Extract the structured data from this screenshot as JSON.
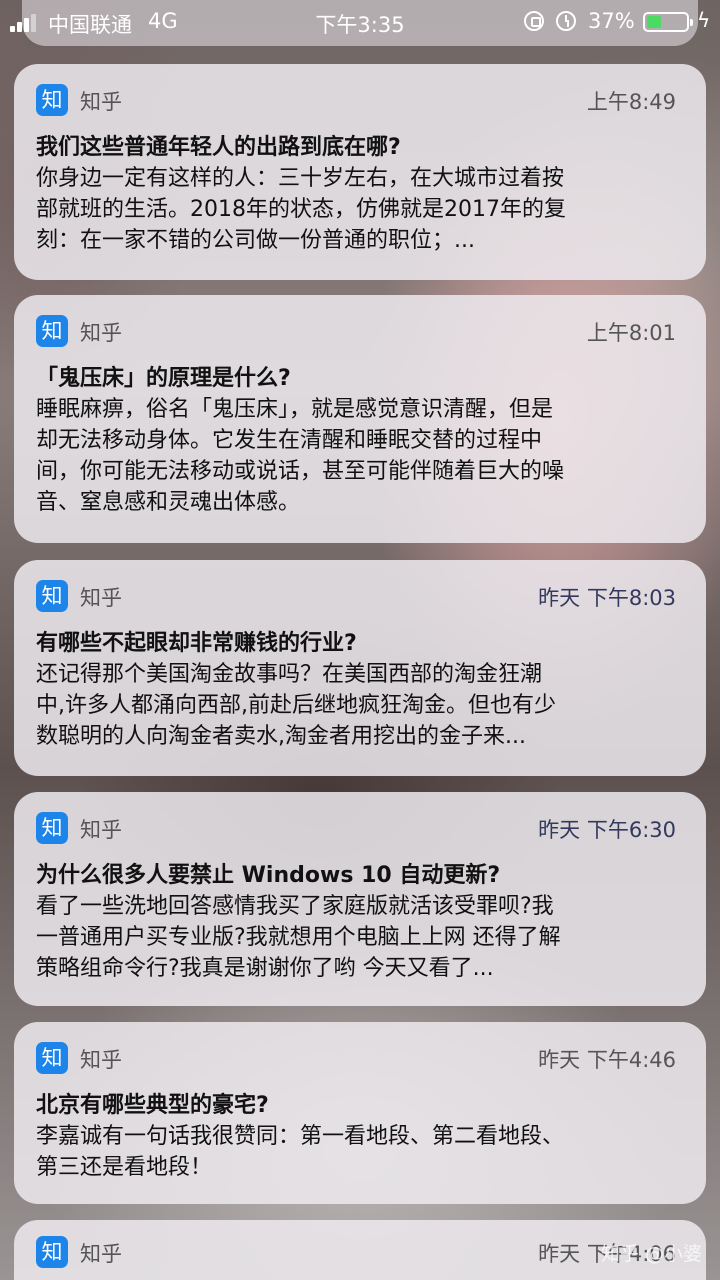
{
  "status_bar": {
    "carrier": "中国联通",
    "network": "4G",
    "time": "下午3:35",
    "battery_percent": "37%",
    "battery_level": 0.37,
    "battery_color": "#4cd964"
  },
  "notifications": [
    {
      "app_icon": "知",
      "app_name": "知乎",
      "time": "上午8:49",
      "title": "我们这些普通年轻人的出路到底在哪?",
      "body": [
        "你身边一定有这样的人：三十岁左右，在大城市过着按",
        "部就班的生活。2018年的状态，仿佛就是2017年的复",
        "刻：在一家不错的公司做一份普通的职位；..."
      ]
    },
    {
      "app_icon": "知",
      "app_name": "知乎",
      "time": "上午8:01",
      "title": "「鬼压床」的原理是什么?",
      "body": [
        "睡眠麻痹，俗名「鬼压床」，就是感觉意识清醒，但是",
        "却无法移动身体。它发生在清醒和睡眠交替的过程中",
        "间，你可能无法移动或说话，甚至可能伴随着巨大的噪",
        "音、窒息感和灵魂出体感。"
      ]
    },
    {
      "app_icon": "知",
      "app_name": "知乎",
      "time": "昨天 下午8:03",
      "title": "有哪些不起眼却非常赚钱的行业?",
      "body": [
        "还记得那个美国淘金故事吗？在美国西部的淘金狂潮",
        "中,许多人都涌向西部,前赴后继地疯狂淘金。但也有少",
        "数聪明的人向淘金者卖水,淘金者用挖出的金子来..."
      ]
    },
    {
      "app_icon": "知",
      "app_name": "知乎",
      "time": "昨天 下午6:30",
      "title": "为什么很多人要禁止 Windows 10 自动更新?",
      "body": [
        "看了一些洗地回答感情我买了家庭版就活该受罪呗?我",
        "一普通用户买专业版?我就想用个电脑上上网 还得了解",
        "策略组命令行?我真是谢谢你了哟 今天又看了..."
      ]
    },
    {
      "app_icon": "知",
      "app_name": "知乎",
      "time": "昨天 下午4:46",
      "title": "北京有哪些典型的豪宅?",
      "body": [
        "李嘉诚有一句话我很赞同：第一看地段、第二看地段、",
        "第三还是看地段！"
      ]
    },
    {
      "app_icon": "知",
      "app_name": "知乎",
      "time": "昨天 下午4:06"
    }
  ],
  "watermark": "知乎 @小婆"
}
